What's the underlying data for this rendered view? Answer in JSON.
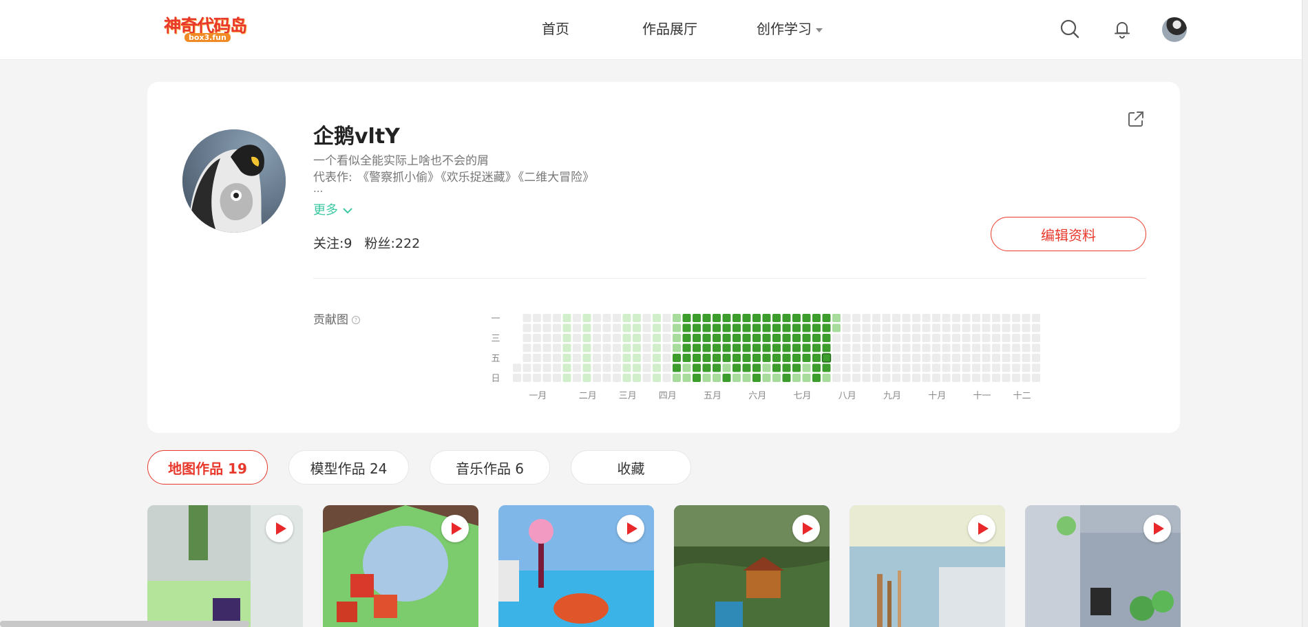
{
  "header": {
    "logo_main": "神奇代码岛",
    "logo_sub": "box3.fun",
    "nav": [
      {
        "label": "首页"
      },
      {
        "label": "作品展厅"
      },
      {
        "label": "创作学习"
      }
    ],
    "icons": [
      "search-icon",
      "bell-icon",
      "user-avatar"
    ]
  },
  "profile": {
    "username": "企鹅vltY",
    "bio": "一个看似全能实际上啥也不会的屑",
    "works_prefix": "代表作:",
    "works": [
      "《警察抓小偷》",
      "《欢乐捉迷藏》",
      "《二维大冒险》"
    ],
    "ellipsis": "...",
    "more_label": "更多",
    "following_label": "关注:",
    "following": "9",
    "followers_label": "粉丝:",
    "followers": "222",
    "edit_label": "编辑资料",
    "contrib_label": "贡献图"
  },
  "heatmap": {
    "day_labels": [
      "一",
      "",
      "三",
      "",
      "五",
      "",
      "日"
    ],
    "month_labels": [
      "一月",
      "二月",
      "三月",
      "四月",
      "五月",
      "六月",
      "七月",
      "八月",
      "九月",
      "十月",
      "十一",
      "十二"
    ],
    "colors": {
      "empty": "#ececec",
      "light": "#d2efcc",
      "mid": "#a8dc9c",
      "dark": "#3c9c2c"
    },
    "weeks": 53,
    "light_weeks": [
      5,
      7,
      11,
      12,
      14
    ],
    "dark_range": [
      16,
      31
    ],
    "level_map_note_legend": "0 empty, 1 light, 2 mid, 3 dark"
  },
  "tabs": [
    {
      "label": "地图作品 19",
      "active": true
    },
    {
      "label": "模型作品 24",
      "active": false
    },
    {
      "label": "音乐作品 6",
      "active": false
    },
    {
      "label": "收藏",
      "active": false
    }
  ],
  "works_cards": [
    {
      "thumb": "#b7c7c0"
    },
    {
      "thumb": "#7fbf72"
    },
    {
      "thumb": "#58b6e0"
    },
    {
      "thumb": "#4f7a3f"
    },
    {
      "thumb": "#9fc3cf"
    },
    {
      "thumb": "#a8b4c2"
    }
  ],
  "colors": {
    "accent": "#e8382b",
    "link": "#3cc8a0"
  }
}
